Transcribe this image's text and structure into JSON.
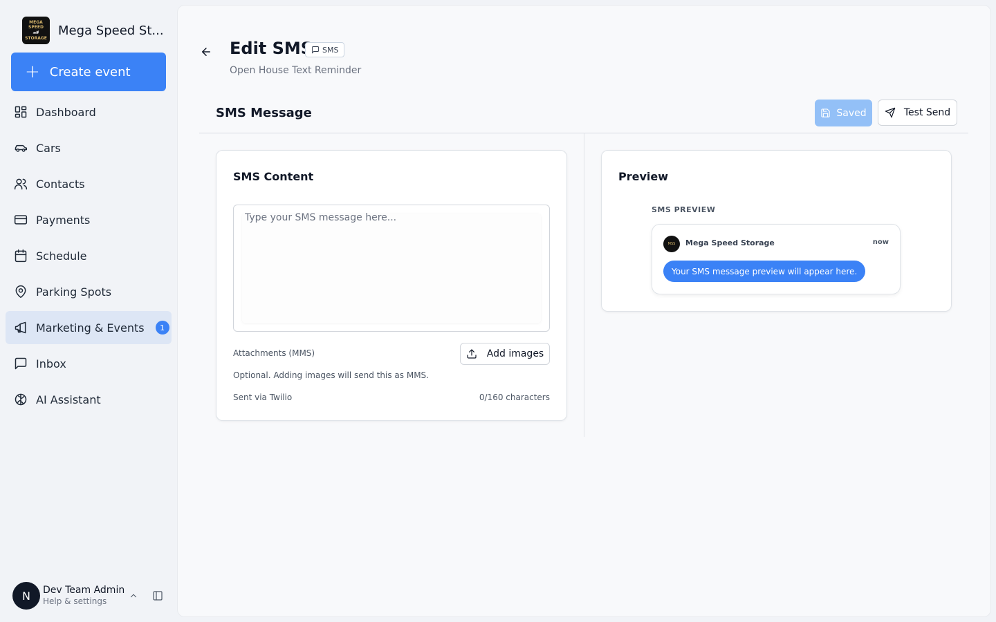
{
  "sidebar": {
    "brand_name": "Mega Speed St...",
    "logo_text": [
      "MEGA SPEED",
      "🏎",
      "STORAGE"
    ],
    "create_label": "Create event",
    "items": [
      {
        "label": "Dashboard",
        "icon": "dashboard-icon"
      },
      {
        "label": "Cars",
        "icon": "car-icon"
      },
      {
        "label": "Contacts",
        "icon": "users-icon"
      },
      {
        "label": "Payments",
        "icon": "credit-card-icon"
      },
      {
        "label": "Schedule",
        "icon": "calendar-icon"
      },
      {
        "label": "Parking Spots",
        "icon": "map-pin-icon"
      },
      {
        "label": "Marketing & Events",
        "icon": "megaphone-icon",
        "badge": "1",
        "active": true
      },
      {
        "label": "Inbox",
        "icon": "message-square-icon"
      },
      {
        "label": "AI Assistant",
        "icon": "brain-icon"
      }
    ],
    "user": {
      "initial": "N",
      "name": "Dev Team Admin",
      "sub": "Help & settings"
    }
  },
  "header": {
    "title": "Edit SMS",
    "type_badge": "SMS",
    "subtitle": "Open House Text Reminder",
    "section_title": "SMS Message",
    "saved_label": "Saved",
    "test_send_label": "Test Send"
  },
  "content": {
    "title": "SMS Content",
    "value": "",
    "placeholder": "Type your SMS message here...",
    "attachments_label": "Attachments (MMS)",
    "add_images_label": "Add images",
    "mms_note": "Optional. Adding images will send this as MMS.",
    "sent_via": "Sent via Twilio",
    "char_count": "0/160 characters"
  },
  "preview": {
    "title": "Preview",
    "label": "SMS PREVIEW",
    "sender": "Mega Speed Storage",
    "time": "now",
    "bubble": "Your SMS message preview will appear here."
  },
  "colors": {
    "accent": "#3b82f6",
    "saved_disabled": "#93c0f7",
    "active_nav_bg": "#dde6f5"
  }
}
